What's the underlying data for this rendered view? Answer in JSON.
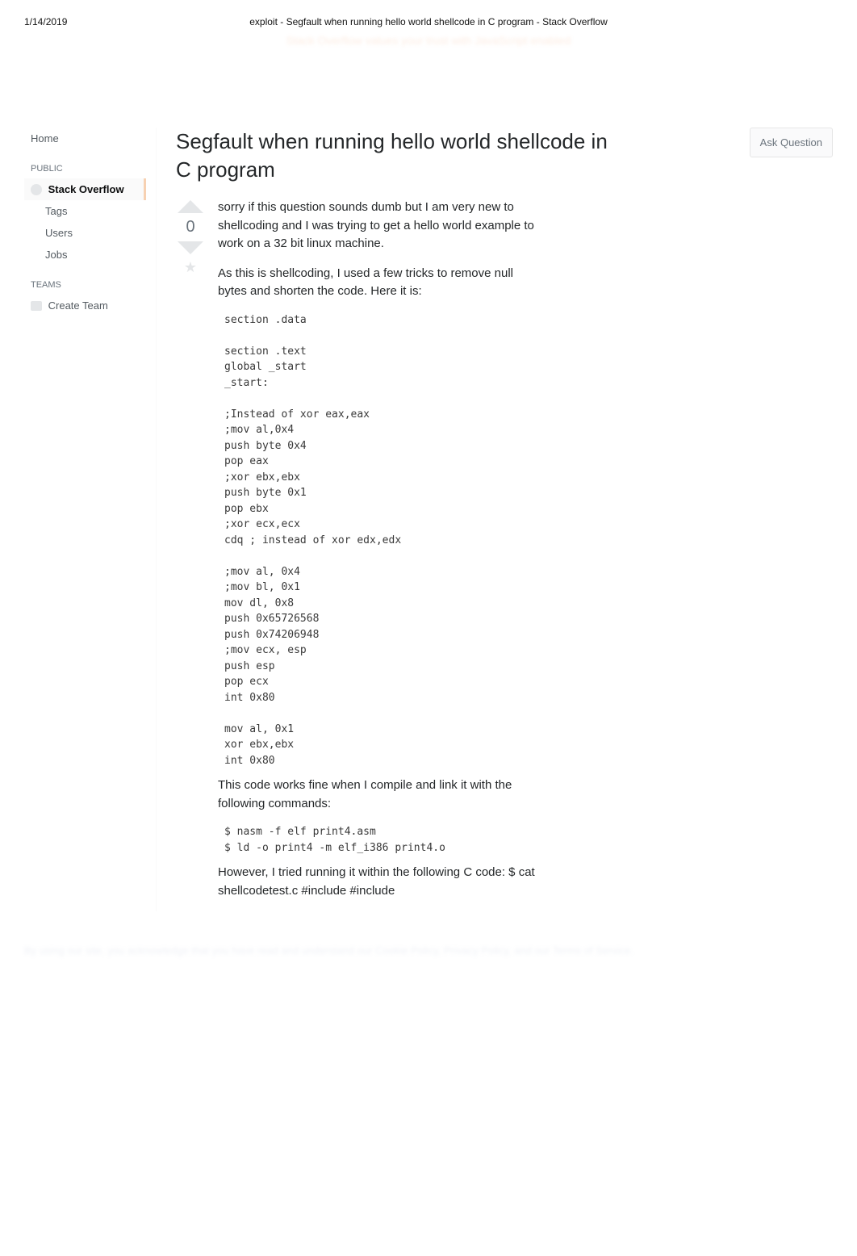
{
  "print": {
    "date": "1/14/2019",
    "title": "exploit - Segfault when running hello world shellcode in C program - Stack Overflow"
  },
  "announcement": "Stack Overflow values your trust with JavaScript enabled",
  "sidebar": {
    "home": "Home",
    "public_label": "PUBLIC",
    "stack_overflow": "Stack Overflow",
    "tags": "Tags",
    "users": "Users",
    "jobs": "Jobs",
    "teams_label": "TEAMS",
    "create_team": "Create Team"
  },
  "question": {
    "title": "Segfault when running hello world shellcode in C program",
    "ask_button": "Ask Question",
    "score": "0",
    "para1": "sorry if this question sounds dumb but I am very new to shellcoding and I was trying to get a hello world example to work on a 32 bit linux machine.",
    "para2": "As this is shellcoding, I used a few tricks to remove null bytes and shorten the code. Here it is:",
    "code1": "section .data\n\nsection .text\nglobal _start\n_start:\n\n;Instead of xor eax,eax\n;mov al,0x4\npush byte 0x4\npop eax\n;xor ebx,ebx\npush byte 0x1\npop ebx\n;xor ecx,ecx\ncdq ; instead of xor edx,edx\n\n;mov al, 0x4\n;mov bl, 0x1\nmov dl, 0x8\npush 0x65726568\npush 0x74206948\n;mov ecx, esp\npush esp\npop ecx\nint 0x80\n\nmov al, 0x1\nxor ebx,ebx\nint 0x80",
    "para3": "This code works fine when I compile and link it with the following commands:",
    "code2": "$ nasm -f elf print4.asm\n$ ld -o print4 -m elf_i386 print4.o",
    "para4": "However, I tried running it within the following C code: $ cat shellcodetest.c #include #include"
  },
  "cookie": "By using our site, you acknowledge that you have read and understand our Cookie Policy, Privacy Policy, and our Terms of Service."
}
